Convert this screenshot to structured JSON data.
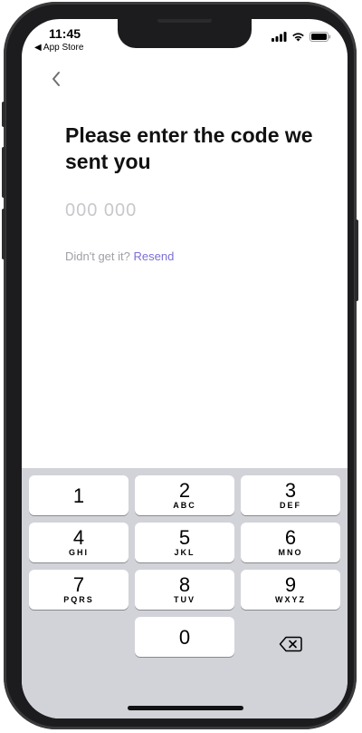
{
  "status_bar": {
    "time": "11:45",
    "back_app": "◀ App Store",
    "icons": [
      "cellular-signal-icon",
      "wifi-icon",
      "battery-icon"
    ]
  },
  "header": {
    "back_icon": "chevron-left-icon"
  },
  "main": {
    "title": "Please enter the code we sent you",
    "code_placeholder": "000 000",
    "code_value": "",
    "resend_prompt": "Didn't get it?",
    "resend_link": "Resend"
  },
  "keypad": {
    "keys": [
      {
        "digit": "1",
        "letters": ""
      },
      {
        "digit": "2",
        "letters": "ABC"
      },
      {
        "digit": "3",
        "letters": "DEF"
      },
      {
        "digit": "4",
        "letters": "GHI"
      },
      {
        "digit": "5",
        "letters": "JKL"
      },
      {
        "digit": "6",
        "letters": "MNO"
      },
      {
        "digit": "7",
        "letters": "PQRS"
      },
      {
        "digit": "8",
        "letters": "TUV"
      },
      {
        "digit": "9",
        "letters": "WXYZ"
      },
      {
        "digit": "0",
        "letters": ""
      }
    ],
    "delete_icon": "backspace-icon"
  },
  "colors": {
    "accent": "#7b6fd6",
    "placeholder": "#c8c8cc",
    "keypad_bg": "#d1d3d9",
    "frame": "#1c1c1e"
  }
}
